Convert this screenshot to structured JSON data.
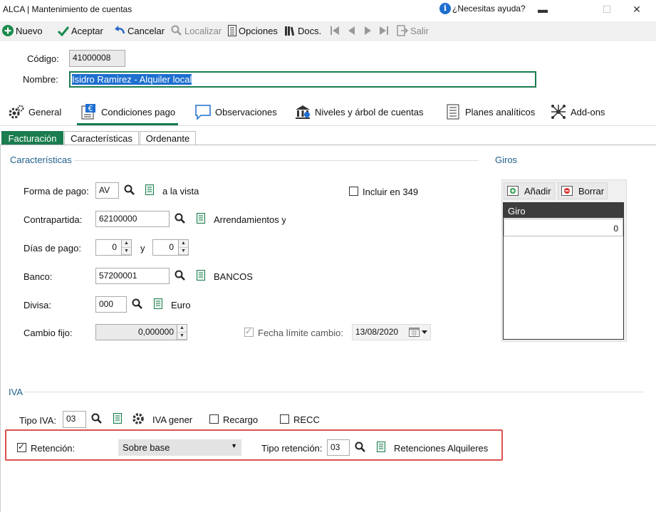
{
  "window": {
    "title": "ALCA | Mantenimiento de cuentas",
    "help_text": "¿Necesitas ayuda?",
    "help_icon_glyph": "i",
    "minimize_glyph": "▬",
    "maximize_glyph": "☐",
    "close_glyph": "✕"
  },
  "toolbar": {
    "nuevo": "Nuevo",
    "aceptar": "Aceptar",
    "cancelar": "Cancelar",
    "localizar": "Localizar",
    "opciones": "Opciones",
    "docs": "Docs.",
    "salir": "Salir"
  },
  "header": {
    "codigo_label": "Código:",
    "codigo_value": "41000008",
    "nombre_label": "Nombre:",
    "nombre_value": "Isidro Ramirez - Alquiler local"
  },
  "module_tabs": [
    {
      "label": "General"
    },
    {
      "label": "Condiciones pago"
    },
    {
      "label": "Observaciones"
    },
    {
      "label": "Niveles y árbol de cuentas"
    },
    {
      "label": "Planes analíticos"
    },
    {
      "label": "Add-ons"
    }
  ],
  "sub_tabs": [
    {
      "label": "Facturación"
    },
    {
      "label": "Características"
    },
    {
      "label": "Ordenante"
    }
  ],
  "caracteristicas": {
    "title": "Características",
    "forma_pago_label": "Forma de pago:",
    "forma_pago_value": "AV",
    "forma_pago_desc": "a la vista",
    "incluir_349_label": "Incluir en 349",
    "contrapartida_label": "Contrapartida:",
    "contrapartida_value": "62100000",
    "contrapartida_desc": "Arrendamientos y",
    "dias_pago_label": "Días de pago:",
    "dias_pago_1": "0",
    "dias_pago_y": "y",
    "dias_pago_2": "0",
    "banco_label": "Banco:",
    "banco_value": "57200001",
    "banco_desc": "BANCOS",
    "divisa_label": "Divisa:",
    "divisa_value": "000",
    "divisa_desc": "Euro",
    "cambio_fijo_label": "Cambio fijo:",
    "cambio_fijo_value": "0,000000",
    "fecha_limite_label": "Fecha límite cambio:",
    "fecha_limite_value": "13/08/2020"
  },
  "giros": {
    "title": "Giros",
    "add_label": "Añadir",
    "delete_label": "Borrar",
    "column_header": "Giro",
    "rows": [
      "0"
    ]
  },
  "iva": {
    "title": "IVA",
    "tipo_iva_label": "Tipo IVA:",
    "tipo_iva_value": "03",
    "tipo_iva_desc": "IVA gener",
    "recargo_label": "Recargo",
    "recc_label": "RECC",
    "retencion_label": "Retención:",
    "retencion_checked": true,
    "retencion_mode": "Sobre base",
    "tipo_retencion_label": "Tipo retención:",
    "tipo_retencion_value": "03",
    "tipo_retencion_desc": "Retenciones Alquileres"
  },
  "colors": {
    "accent_green": "#1a7c4f",
    "highlight_red": "#d9534f",
    "section_blue": "#1f5f8b"
  }
}
